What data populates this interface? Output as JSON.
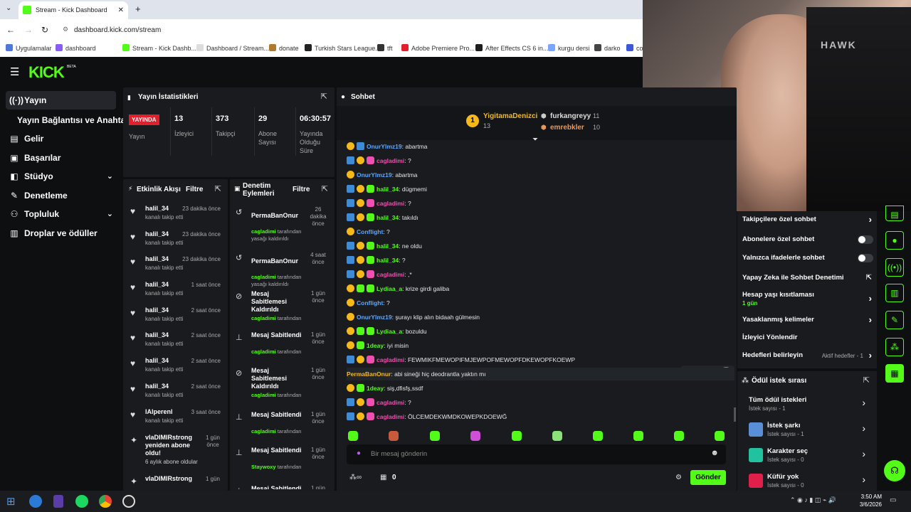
{
  "browser": {
    "tab_title": "Stream - Kick Dashboard",
    "url": "dashboard.kick.com/stream",
    "bookmarks": [
      "Uygulamalar",
      "dashboard",
      "Stream - Kick Dashb...",
      "Dashboard / Stream...",
      "donate",
      "Turkish Stars League...",
      "tft",
      "Adobe Premiere Pro...",
      "After Effects CS 6 in...",
      "kurgu dersi",
      "darko",
      "co"
    ]
  },
  "app": {
    "logo": "KICK",
    "logo_badge": "BETA"
  },
  "nav": {
    "items": [
      {
        "label": "Yayın",
        "icon": "broadcast-icon"
      },
      {
        "label": "Yayın Bağlantısı ve Anahtarı",
        "icon": ""
      },
      {
        "label": "Gelir",
        "icon": "revenue-icon"
      },
      {
        "label": "Başarılar",
        "icon": "achievements-icon"
      },
      {
        "label": "Stüdyo",
        "icon": "studio-icon"
      },
      {
        "label": "Denetleme",
        "icon": "wrench-icon"
      },
      {
        "label": "Topluluk",
        "icon": "community-icon"
      },
      {
        "label": "Droplar ve ödüller",
        "icon": "drops-icon"
      }
    ]
  },
  "stats": {
    "title": "Yayın İstatistikleri",
    "live_badge": "YAYINDA",
    "items": [
      {
        "value": "",
        "label": "Yayın"
      },
      {
        "value": "13",
        "label": "İzleyici"
      },
      {
        "value": "373",
        "label": "Takipçi"
      },
      {
        "value": "29",
        "label": "Abone Sayısı"
      },
      {
        "value": "06:30:57",
        "label": "Yayında Olduğu Süre"
      }
    ]
  },
  "activity": {
    "title": "Etkinlik Akışı",
    "filter": "Filtre",
    "rows": [
      {
        "name": "halil_34",
        "sub": "kanalı takip etti",
        "time": "23 dakika önce"
      },
      {
        "name": "halil_34",
        "sub": "kanalı takip etti",
        "time": "23 dakika önce"
      },
      {
        "name": "halil_34",
        "sub": "kanalı takip etti",
        "time": "23 dakika önce"
      },
      {
        "name": "halil_34",
        "sub": "kanalı takip etti",
        "time": "1 saat önce"
      },
      {
        "name": "halil_34",
        "sub": "kanalı takip etti",
        "time": "2 saat önce"
      },
      {
        "name": "halil_34",
        "sub": "kanalı takip etti",
        "time": "2 saat önce"
      },
      {
        "name": "halil_34",
        "sub": "kanalı takip etti",
        "time": "2 saat önce"
      },
      {
        "name": "halil_34",
        "sub": "kanalı takip etti",
        "time": "2 saat önce"
      },
      {
        "name": "lAlperenl",
        "sub": "kanalı takip etti",
        "time": "3 saat önce"
      },
      {
        "name": "vlaDIMIRstrong yeniden abone oldu!",
        "sub": "6 aylık abone oldular",
        "time": "1 gün önce"
      },
      {
        "name": "vlaDIMIRstrong",
        "sub": "",
        "time": "1 gün"
      }
    ]
  },
  "moderation": {
    "title": "Denetim Eylemleri",
    "filter": "Filtre",
    "rows": [
      {
        "name": "PermaBanOnur",
        "by": "cagladimi",
        "suffix": "tarafından yasağı kaldırıldı",
        "time": "26 dakika önce"
      },
      {
        "name": "PermaBanOnur",
        "by": "cagladimi",
        "suffix": "tarafından yasağı kaldırıldı",
        "time": "4 saat önce"
      },
      {
        "name": "Mesaj Sabitlemesi Kaldırıldı",
        "by": "cagladimi",
        "suffix": "tarafından",
        "time": "1 gün önce"
      },
      {
        "name": "Mesaj Sabitlendi",
        "by": "cagladimi",
        "suffix": "tarafından",
        "time": "1 gün önce"
      },
      {
        "name": "Mesaj Sabitlemesi Kaldırıldı",
        "by": "cagladimi",
        "suffix": "tarafından",
        "time": "1 gün önce"
      },
      {
        "name": "Mesaj Sabitlendi",
        "by": "cagladimi",
        "suffix": "tarafından",
        "time": "1 gün önce"
      },
      {
        "name": "Mesaj Sabitlendi",
        "by": "Staywoxy",
        "suffix": "tarafından",
        "time": "1 gün önce"
      },
      {
        "name": "Mesaj Sabitlendi",
        "by": "",
        "suffix": "",
        "time": "1 gün önce"
      }
    ]
  },
  "chat": {
    "title": "Sohbet",
    "top_gifters": [
      {
        "rank": "1",
        "name": "YigitamaDenizci",
        "count": "13"
      },
      {
        "rank": "2",
        "name": "furkangreyy",
        "count": "11"
      },
      {
        "rank": "3",
        "name": "emrebkler",
        "count": "10"
      }
    ],
    "messages": [
      {
        "user": "OnurYlmz19",
        "color": "#5ba7ff",
        "text": "abartma",
        "badges": [
          "gold",
          "blue"
        ]
      },
      {
        "user": "cagladimi",
        "color": "#ee4fb0",
        "text": "?",
        "badges": [
          "blue",
          "gold",
          "pink"
        ]
      },
      {
        "user": "OnurYlmz19",
        "color": "#5ba7ff",
        "text": "abartma",
        "badges": [
          "gold"
        ]
      },
      {
        "user": "halil_34",
        "color": "#53fc18",
        "text": "dügmemi",
        "badges": [
          "blue",
          "gold",
          "green"
        ]
      },
      {
        "user": "cagladimi",
        "color": "#ee4fb0",
        "text": "?",
        "badges": [
          "blue",
          "gold",
          "pink"
        ]
      },
      {
        "user": "halil_34",
        "color": "#53fc18",
        "text": "takıldı",
        "badges": [
          "blue",
          "gold",
          "green"
        ]
      },
      {
        "user": "Conflight",
        "color": "#5ba7ff",
        "text": "?",
        "badges": [
          "gold"
        ]
      },
      {
        "user": "halil_34",
        "color": "#53fc18",
        "text": "ne oldu",
        "badges": [
          "blue",
          "gold",
          "green"
        ]
      },
      {
        "user": "halil_34",
        "color": "#53fc18",
        "text": "?",
        "badges": [
          "blue",
          "gold",
          "green"
        ]
      },
      {
        "user": "cagladimi",
        "color": "#ee4fb0",
        "text": ",*",
        "badges": [
          "blue",
          "gold",
          "pink"
        ]
      },
      {
        "user": "Lydiaa_a",
        "color": "#53fc18",
        "text": "krize girdi galiba",
        "badges": [
          "gold",
          "green",
          "green"
        ]
      },
      {
        "user": "Conflight",
        "color": "#5ba7ff",
        "text": "?",
        "badges": [
          "gold"
        ]
      },
      {
        "user": "OnurYlmz19",
        "color": "#5ba7ff",
        "text": "şurayı klip alın bidaah gülmesin",
        "badges": [
          "gold"
        ]
      },
      {
        "user": "Lydiaa_a",
        "color": "#53fc18",
        "text": "bozuldu",
        "badges": [
          "gold",
          "green",
          "green"
        ]
      },
      {
        "user": "1deay",
        "color": "#53fc18",
        "text": "iyi misin",
        "badges": [
          "gold",
          "green"
        ]
      },
      {
        "user": "cagladimi",
        "color": "#ee4fb0",
        "text": "FEWMIKFMEWOPIFMJEWPOFMEWOPFDKEWOPFKOEWP",
        "badges": [
          "blue",
          "gold",
          "pink"
        ]
      },
      {
        "user": "PermaBanOnur",
        "color": "#f6b91b",
        "text": "abi sineği hiç deodrantla yaktın mı",
        "badges": []
      },
      {
        "user": "1deay",
        "color": "#53fc18",
        "text": "siş,dfisfş,ssdf",
        "badges": [
          "gold",
          "green"
        ]
      },
      {
        "user": "cagladimi",
        "color": "#ee4fb0",
        "text": "?",
        "badges": [
          "blue",
          "gold",
          "pink"
        ]
      },
      {
        "user": "cagladimi",
        "color": "#ee4fb0",
        "text": "ÖLCEMDEKWMDKOWEPKDOEWĞ",
        "badges": [
          "blue",
          "gold",
          "pink"
        ]
      }
    ],
    "input_placeholder": "Bir mesaj gönderin",
    "points": "0",
    "send_label": "Gönder"
  },
  "chat_settings": {
    "items": [
      {
        "label": "Takipçilere özel sohbet",
        "control": "chevron"
      },
      {
        "label": "Abonelere özel sohbet",
        "control": "toggle"
      },
      {
        "label": "Yalnızca ifadelerle sohbet",
        "control": "toggle"
      },
      {
        "label": "Yapay Zeka ile Sohbet Denetimi",
        "control": "link"
      },
      {
        "label": "Hesap yaşı kısıtlaması",
        "sub": "1 gün",
        "control": "chevron"
      },
      {
        "label": "Yasaklanmış kelimeler",
        "control": "chevron"
      },
      {
        "label": "İzleyici Yönlendir",
        "control": ""
      },
      {
        "label": "Hedefleri belirleyin",
        "note": "Aktif hedefler - 1",
        "control": "chevron"
      }
    ]
  },
  "rewards": {
    "title": "Ödül istek sırası",
    "items": [
      {
        "label": "Tüm ödül istekleri",
        "sub": "İstek sayısı - 1"
      },
      {
        "label": "İstek şarkı",
        "sub": "İstek sayısı - 1"
      },
      {
        "label": "Karakter seç",
        "sub": "İstek sayısı - 0"
      },
      {
        "label": "Küfür yok",
        "sub": "İstek sayısı - 0"
      }
    ]
  },
  "taskbar": {
    "time": "3:50 AM",
    "date": "3/6/2026"
  },
  "colors": {
    "accent": "#53fc18",
    "bg": "#0e0f10",
    "panel": "#191b1f",
    "live": "#e0202a"
  }
}
